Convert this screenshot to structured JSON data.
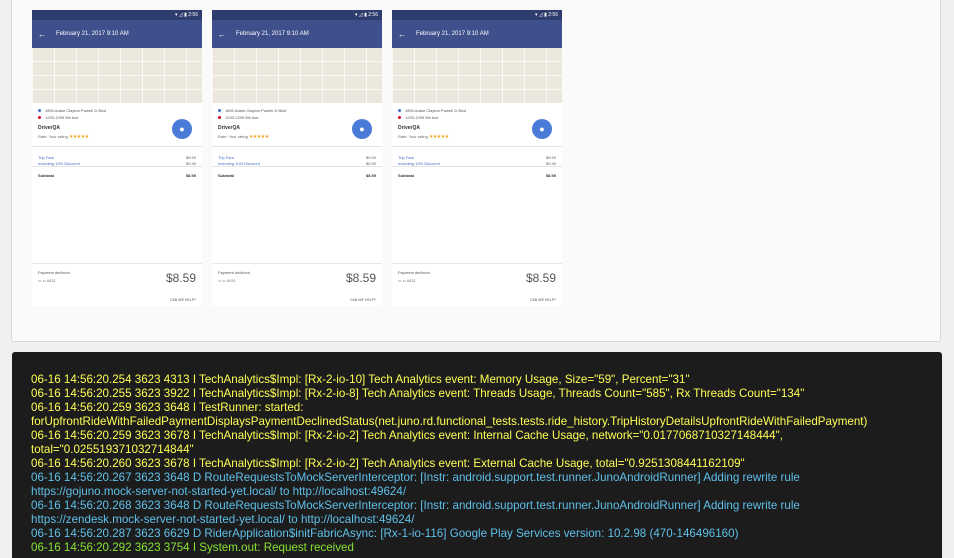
{
  "screens": [
    {
      "status_icons": "▾ ◿ ▮ 2:56",
      "title": "February 21, 2017 9:10 AM",
      "pickup": "1800 Adam Clayton Powell Jr Blvd",
      "dropoff": "1293-1299 5th Ave",
      "driver_name": "DriverQA",
      "rating_label": "Rate: Your rating",
      "stars": "★★★★★",
      "trip_fare_label": "Trip Fare",
      "trip_fare_value": "$9.59",
      "discount_label": "Including 10% Discount",
      "discount_value": "$0.99",
      "subtotal_label": "Subtotal",
      "subtotal_value": "$8.59",
      "declined_label": "Payment declined",
      "card": "▭ •• 8431",
      "amount": "$8.59",
      "help": "CAN WE HELP?"
    },
    {
      "status_icons": "▾ ◿ ▮ 2:56",
      "title": "February 21, 2017 9:10 AM",
      "pickup": "1800 Adam Clayton Powell Jr Blvd",
      "dropoff": "1293-1299 5th Ave",
      "driver_name": "DriverQA",
      "rating_label": "Rate: Your rating",
      "stars": "★★★★★",
      "trip_fare_label": "Trip Fare",
      "trip_fare_value": "$9.59",
      "discount_label": "Including 10% Discount",
      "discount_value": "$0.99",
      "subtotal_label": "Subtotal",
      "subtotal_value": "$8.59",
      "declined_label": "Payment declined",
      "card": "▭ •• 8431",
      "amount": "$8.59",
      "help": "CAN WE HELP?"
    },
    {
      "status_icons": "▾ ◿ ▮ 2:56",
      "title": "February 21, 2017 9:10 AM",
      "pickup": "1800 Adam Clayton Powell Jr Blvd",
      "dropoff": "1293-1299 5th Ave",
      "driver_name": "DriverQA",
      "rating_label": "Rate: Your rating",
      "stars": "★★★★★",
      "trip_fare_label": "Trip Fare",
      "trip_fare_value": "$9.59",
      "discount_label": "Including 10% Discount",
      "discount_value": "$0.99",
      "subtotal_label": "Subtotal",
      "subtotal_value": "$8.59",
      "declined_label": "Payment declined",
      "card": "▭ •• 8431",
      "amount": "$8.59",
      "help": "CAN WE HELP?"
    }
  ],
  "log": {
    "colors": {
      "info": "#ffff55",
      "debug": "#5fc0ea",
      "sysout": "#8ae234"
    },
    "lines": [
      {
        "text": "06-16 14:56:20.254 3623 4313 I TechAnalytics$Impl: [Rx-2-io-10] Tech Analytics event: Memory Usage, Size=\"59\", Percent=\"31\"",
        "level": "info"
      },
      {
        "text": "06-16 14:56:20.255 3623 3922 I TechAnalytics$Impl: [Rx-2-io-8] Tech Analytics event: Threads Usage, Threads Count=\"585\", Rx Threads Count=\"134\"",
        "level": "info"
      },
      {
        "text": "06-16 14:56:20.259 3623 3648 I TestRunner: started:",
        "level": "info"
      },
      {
        "text": "forUpfrontRideWithFailedPaymentDisplaysPaymentDeclinedStatus(net.juno.rd.functional_tests.tests.ride_history.TripHistoryDetailsUpfrontRideWithFailedPayment)",
        "level": "info"
      },
      {
        "text": "06-16 14:56:20.259 3623 3678 I TechAnalytics$Impl: [Rx-2-io-2] Tech Analytics event: Internal Cache Usage, network=\"0.0177068710327148444\",",
        "level": "info"
      },
      {
        "text": "total=\"0.025519371032714844\"",
        "level": "info"
      },
      {
        "text": "06-16 14:56:20.260 3623 3678 I TechAnalytics$Impl: [Rx-2-io-2] Tech Analytics event: External Cache Usage, total=\"0.9251308441162109\"",
        "level": "info"
      },
      {
        "text": "06-16 14:56:20.267 3623 3648 D RouteRequestsToMockServerInterceptor: [Instr: android.support.test.runner.JunoAndroidRunner] Adding rewrite rule",
        "level": "debug"
      },
      {
        "text": "https://gojuno.mock-server-not-started-yet.local/ to http://localhost:49624/",
        "level": "debug"
      },
      {
        "text": "06-16 14:56:20.268 3623 3648 D RouteRequestsToMockServerInterceptor: [Instr: android.support.test.runner.JunoAndroidRunner] Adding rewrite rule",
        "level": "debug"
      },
      {
        "text": "https://zendesk.mock-server-not-started-yet.local/ to http://localhost:49624/",
        "level": "debug"
      },
      {
        "text": "06-16 14:56:20.287 3623 6629 D RiderApplication$initFabricAsync: [Rx-1-io-116] Google Play Services version: 10.2.98 (470-146496160)",
        "level": "debug"
      },
      {
        "text": "06-16 14:56:20.292 3623 3754 I System.out: Request received",
        "level": "sysout"
      }
    ]
  }
}
